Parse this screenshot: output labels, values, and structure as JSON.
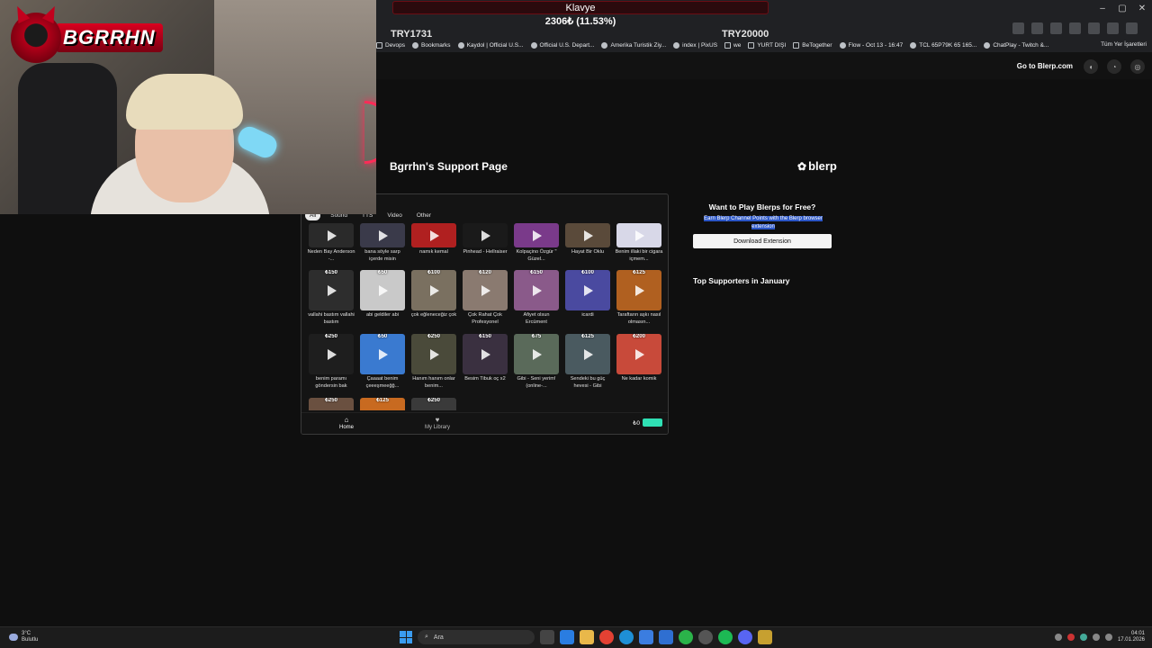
{
  "overlay": {
    "logo_text": "BGRRHN",
    "goal_title": "Klavye",
    "goal_amount": "2306₺ (11.53%)",
    "goal_left": "TRY1731",
    "goal_right": "TRY20000"
  },
  "bookmarks": [
    {
      "label": "Devops",
      "icon": "folder-icon"
    },
    {
      "label": "Bookmarks",
      "icon": "globe-icon"
    },
    {
      "label": "Kaydol | Official U.S...",
      "icon": "globe-icon"
    },
    {
      "label": "Official U.S. Depart...",
      "icon": "globe-icon"
    },
    {
      "label": "Amerika Turistik Ziy...",
      "icon": "globe-icon"
    },
    {
      "label": "index | PixUS",
      "icon": "globe-icon"
    },
    {
      "label": "we",
      "icon": "folder-icon"
    },
    {
      "label": "YURT DIŞI",
      "icon": "folder-icon"
    },
    {
      "label": "BeTogether",
      "icon": "folder-icon"
    },
    {
      "label": "Flow - Oct 13 - 16:47",
      "icon": "globe-icon"
    },
    {
      "label": "TCL 65P79K 65 165...",
      "icon": "globe-icon"
    },
    {
      "label": "ChatPlay - Twitch &...",
      "icon": "globe-icon"
    }
  ],
  "bookmarks_right": "Tüm Yer İşaretleri",
  "header": {
    "goto_link": "Go to Blerp.com"
  },
  "page": {
    "support_title": "Bgrrhn's Support Page",
    "blerp_logo": "blerp"
  },
  "panel": {
    "tabs": [
      "All",
      "Sound",
      "TTS",
      "Video",
      "Other"
    ],
    "active_tab": "All",
    "top_row": [
      {
        "label": "Neden Bay Anderson -..."
      },
      {
        "label": "bana söyle sarp içerde misin"
      },
      {
        "label": "namık kemal"
      },
      {
        "label": "Pinhead - Hellraiser"
      },
      {
        "label": "Kolpaçino Özgür \" Güzel..."
      },
      {
        "label": "Hayat Bir Oklu"
      },
      {
        "label": "Benim illaki bir cigara içmem..."
      }
    ],
    "items": [
      {
        "price": "₺150",
        "label": "vallahi bastım vallahi bastım",
        "color": "#2d2d2d"
      },
      {
        "price": "₺50",
        "label": "abi geldiler abi",
        "color": "#c9c9c9"
      },
      {
        "price": "₺100",
        "label": "çok eğleneceğiz çok",
        "color": "#7a7060"
      },
      {
        "price": "₺120",
        "label": "Çok Rahat Çok Profesyonel",
        "color": "#8a7a70"
      },
      {
        "price": "₺150",
        "label": "Afiyet olsun Ercüment",
        "color": "#8a5a8a"
      },
      {
        "price": "₺100",
        "label": "icardi",
        "color": "#4a4aa0"
      },
      {
        "price": "₺125",
        "label": "Taraftarın aşkı nasıl olmasın...",
        "color": "#b06020"
      },
      {
        "price": "₺250",
        "label": "benim paramı göndersin bak",
        "color": "#1e1e1e"
      },
      {
        "price": "₺50",
        "label": "Çaaaat benim çeeeşmeeğğ...",
        "color": "#3a7ad0"
      },
      {
        "price": "₺250",
        "label": "Hanım hanım onlar benim...",
        "color": "#4a4a3a"
      },
      {
        "price": "₺150",
        "label": "Besim Tibuk oç x2",
        "color": "#3a3040"
      },
      {
        "price": "₺75",
        "label": "Gibi - Seni yerim! (online-...",
        "color": "#5a6a5a"
      },
      {
        "price": "₺125",
        "label": "Sendeki bu güç hevesi - Gibi",
        "color": "#4a5a60"
      },
      {
        "price": "₺200",
        "label": "Ne kadar komik",
        "color": "#c84a3a"
      }
    ],
    "partial_row": [
      {
        "price": "₺250",
        "color": "#6a5040"
      },
      {
        "price": "₺125",
        "color": "#c86a20"
      },
      {
        "price": "₺250",
        "color": "#3a3a3a"
      }
    ],
    "footer": {
      "home": "Home",
      "library": "My Library",
      "balance": "₺0"
    }
  },
  "promo": {
    "title": "Want to Play Blerps for Free?",
    "subtitle": "Earn Blerp Channel Points with the Blerp browser extension",
    "button": "Download Extension"
  },
  "supporters_title": "Top Supporters in January",
  "taskbar": {
    "weather_temp": "3°C",
    "weather_desc": "Bulutlu",
    "search_placeholder": "Ara",
    "time": "04:01",
    "date": "17.01.2026"
  }
}
